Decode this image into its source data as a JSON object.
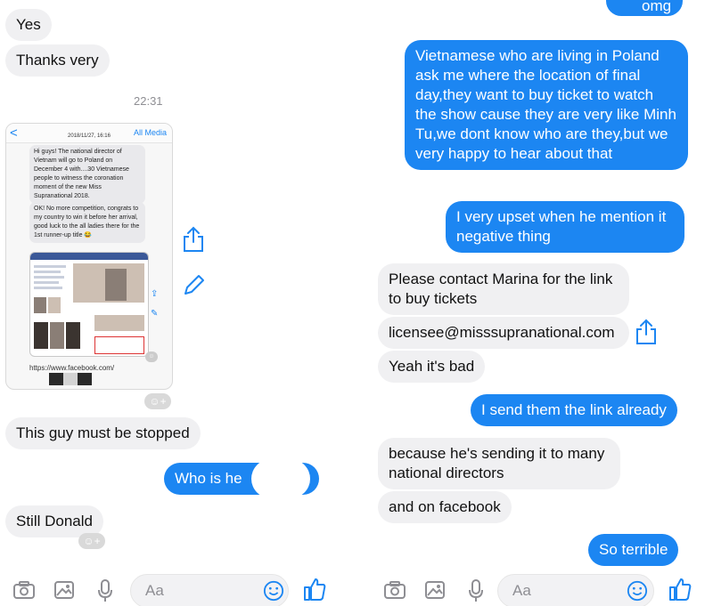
{
  "left": {
    "messages": [
      {
        "text": "Yes"
      },
      {
        "text": "Thanks very"
      }
    ],
    "timestamp": "22:31",
    "shared_screenshot": {
      "back": "<",
      "all_media": "All Media",
      "date": "2018/11/27, 16:16",
      "msg1": "Hi guys! The national director of Vietnam will go to Poland on December 4 with....30 Vietnamese people to witness the coronation moment of the new Miss Supranational 2018.",
      "msg2": "OK! No more competition, congrats to my country to win it before her arrival, good luck to the all ladies there for the 1st runner-up title 😂",
      "link": "https://www.facebook.com/"
    },
    "messages2": [
      {
        "text": "This guy must be stopped"
      },
      {
        "text": "Who is he"
      },
      {
        "text": "Still Donald"
      }
    ],
    "composer": {
      "placeholder": "Aa"
    }
  },
  "right": {
    "top_partial": "omg",
    "messages": [
      {
        "text": "Vietnamese who are living in Poland ask me where the location of final day,they want to buy ticket to watch the show cause they are very like Minh Tu,we dont know who are they,but we very happy to hear about that"
      },
      {
        "text": "I very upset when he mention it negative thing"
      },
      {
        "text": "Please contact Marina for the link to buy tickets"
      },
      {
        "text": "licensee@misssupranational.com"
      },
      {
        "text": "Yeah it's bad"
      },
      {
        "text": "I send them the link already"
      },
      {
        "text": "because he's sending it to many national directors"
      },
      {
        "text": "and on facebook"
      },
      {
        "text": "So terrible"
      }
    ],
    "composer": {
      "placeholder": "Aa"
    }
  },
  "colors": {
    "sent": "#1c86f2",
    "received": "#f0f0f2",
    "accent": "#1c86f2"
  },
  "icons": [
    "camera-icon",
    "photo-icon",
    "microphone-icon",
    "emoji-icon",
    "thumbs-up-icon",
    "share-icon",
    "edit-icon",
    "add-reaction-icon"
  ]
}
